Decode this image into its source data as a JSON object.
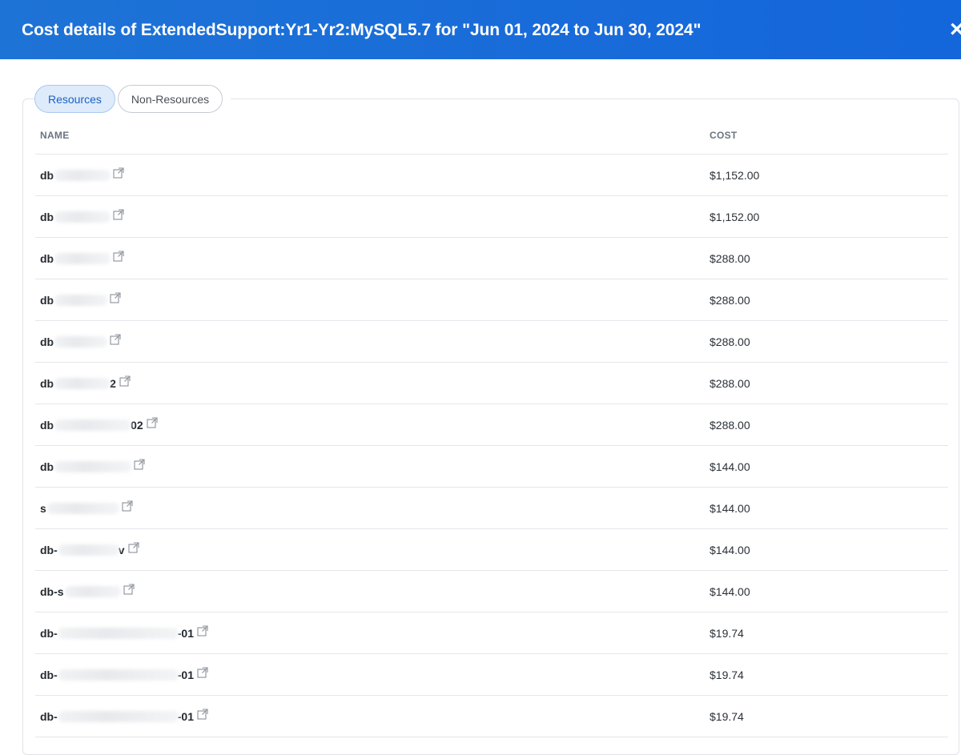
{
  "header": {
    "title": "Cost details of ExtendedSupport:Yr1-Yr2:MySQL5.7 for \"Jun 01, 2024 to Jun 30, 2024\"",
    "close_label": "×"
  },
  "tabs": [
    {
      "label": "Resources",
      "active": true
    },
    {
      "label": "Non-Resources",
      "active": false
    }
  ],
  "table": {
    "columns": [
      "NAME",
      "COST"
    ],
    "rows": [
      {
        "prefix": "db",
        "suffix": "",
        "cost": "$1,152.00"
      },
      {
        "prefix": "db",
        "suffix": "",
        "cost": "$1,152.00"
      },
      {
        "prefix": "db",
        "suffix": "",
        "cost": "$288.00"
      },
      {
        "prefix": "db",
        "suffix": "",
        "cost": "$288.00"
      },
      {
        "prefix": "db",
        "suffix": "",
        "cost": "$288.00"
      },
      {
        "prefix": "db",
        "suffix": "2",
        "cost": "$288.00"
      },
      {
        "prefix": "db",
        "suffix": "02",
        "cost": "$288.00"
      },
      {
        "prefix": "db",
        "suffix": "",
        "cost": "$144.00"
      },
      {
        "prefix": "s",
        "suffix": "",
        "cost": "$144.00"
      },
      {
        "prefix": "db-",
        "suffix": "v",
        "cost": "$144.00"
      },
      {
        "prefix": "db-s",
        "suffix": "",
        "cost": "$144.00"
      },
      {
        "prefix": "db-",
        "suffix": "-01",
        "cost": "$19.74"
      },
      {
        "prefix": "db-",
        "suffix": "-01",
        "cost": "$19.74"
      },
      {
        "prefix": "db-",
        "suffix": "-01",
        "cost": "$19.74"
      }
    ]
  },
  "icons": {
    "external_link": "external-link-icon",
    "close": "close-icon"
  },
  "colors": {
    "header_bg": "#1466db",
    "active_tab_bg": "#deebfa",
    "active_tab_text": "#1a62c4"
  }
}
